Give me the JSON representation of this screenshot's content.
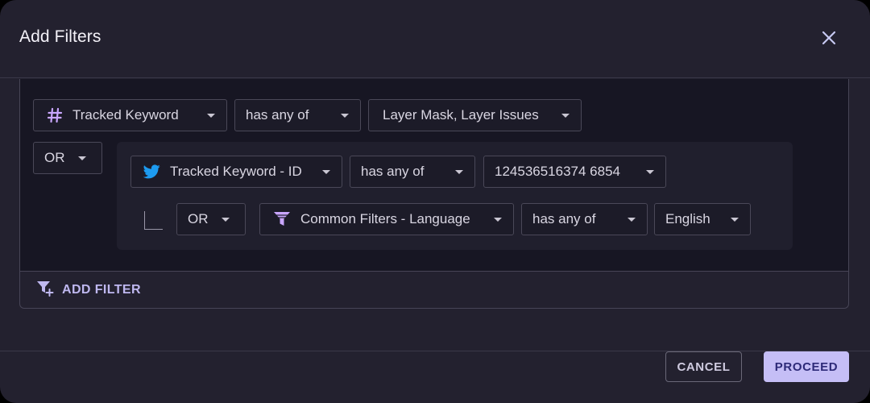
{
  "dialog": {
    "title": "Add Filters",
    "close_icon": "close-icon"
  },
  "filters": {
    "row1": {
      "field": {
        "icon": "hashtag-icon",
        "label": "Tracked Keyword"
      },
      "operator": "has any of",
      "value": "Layer Mask, Layer Issues"
    },
    "conjunction": "OR",
    "nested": {
      "row1": {
        "field": {
          "icon": "twitter-icon",
          "label": "Tracked Keyword - ID"
        },
        "operator": "has any of",
        "value": "124536516374 6854"
      },
      "conjunction": "OR",
      "row2": {
        "field": {
          "icon": "funnel-icon",
          "label": "Common Filters - Language"
        },
        "operator": "has any of",
        "value": "English"
      }
    }
  },
  "add_filter": {
    "label": "ADD FILTER",
    "icon": "filter-add-icon"
  },
  "actions": {
    "cancel": "CANCEL",
    "proceed": "PROCEED"
  },
  "colors": {
    "background": "#23212f",
    "panel": "#171623",
    "accent": "#c5bef6",
    "accent_text": "#2d2a78",
    "icon_purple": "#c9a6ff",
    "twitter_blue": "#1d9bf0"
  }
}
